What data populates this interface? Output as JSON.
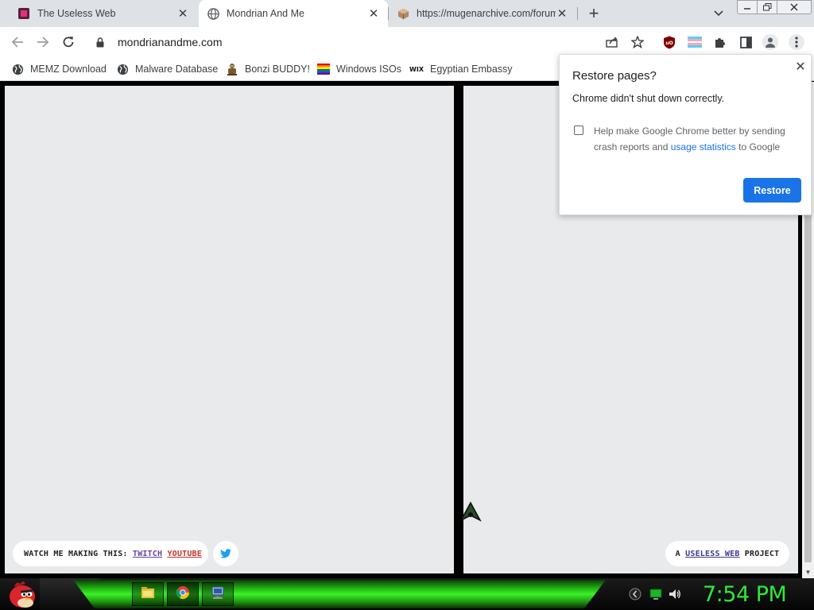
{
  "browser": {
    "tabs": [
      {
        "title": "The Useless Web",
        "icon": "useless-web-favicon",
        "active": false
      },
      {
        "title": "Mondrian And Me",
        "icon": "globe-icon",
        "active": true
      },
      {
        "title": "https://mugenarchive.com/forum",
        "icon": "package-favicon",
        "active": false
      }
    ],
    "new_tab": "+",
    "address": "mondrianandme.com"
  },
  "bookmarks": [
    {
      "label": "MEMZ Download",
      "icon": "globe-icon"
    },
    {
      "label": "Malware Database",
      "icon": "globe-icon"
    },
    {
      "label": "Bonzi BUDDY!",
      "icon": "bonzi-icon"
    },
    {
      "label": "Windows ISOs",
      "icon": "rainbow-flag-icon"
    },
    {
      "label": "Egyptian Embassy",
      "icon": "wix-icon"
    }
  ],
  "wix_text": "WIX",
  "page": {
    "watch_prefix": "WATCH ME MAKING THIS:",
    "twitch": "TWITCH",
    "youtube": "YOUTUBE",
    "useless_a": "A",
    "useless_link": "USELESS WEB",
    "useless_suffix": "PROJECT"
  },
  "dialog": {
    "title": "Restore pages?",
    "message": "Chrome didn't shut down correctly.",
    "checkbox_text": "Help make Google Chrome better by sending crash reports and",
    "checkbox_link": "usage statistics",
    "checkbox_tail": "to Google",
    "restore_label": "Restore",
    "checkbox_checked": false
  },
  "taskbar": {
    "clock": "7:54 PM",
    "apps": [
      "file-explorer-icon",
      "chrome-icon",
      "computer-icon"
    ]
  },
  "colors": {
    "accent": "#1a73e8",
    "clock": "#2ee83a",
    "panel": "#e9eaec"
  }
}
